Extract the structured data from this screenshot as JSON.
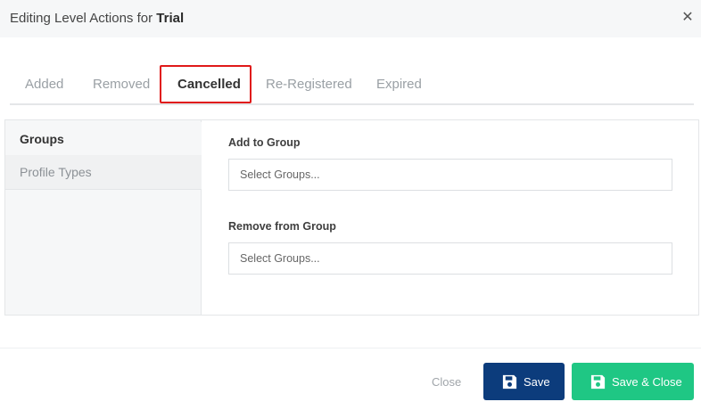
{
  "header": {
    "title_prefix": "Editing Level Actions for ",
    "title_level": "Trial"
  },
  "tabs": [
    {
      "label": "Added",
      "active": false
    },
    {
      "label": "Removed",
      "active": false
    },
    {
      "label": "Cancelled",
      "active": true
    },
    {
      "label": "Re-Registered",
      "active": false
    },
    {
      "label": "Expired",
      "active": false
    }
  ],
  "sidebar": {
    "items": [
      {
        "label": "Groups",
        "active": true
      },
      {
        "label": "Profile Types",
        "active": false
      }
    ]
  },
  "form": {
    "add_to_group": {
      "label": "Add to Group",
      "placeholder": "Select Groups..."
    },
    "remove_from_group": {
      "label": "Remove from Group",
      "placeholder": "Select Groups..."
    }
  },
  "footer": {
    "close_label": "Close",
    "save_label": "Save",
    "save_close_label": "Save & Close"
  },
  "colors": {
    "save_button": "#0c3c7c",
    "save_close_button": "#1fc784",
    "active_tab_highlight": "#e01919",
    "active_tab_underline": "#2a8bd6"
  },
  "icons": {
    "close": "close-icon",
    "save": "floppy-disk-icon"
  }
}
